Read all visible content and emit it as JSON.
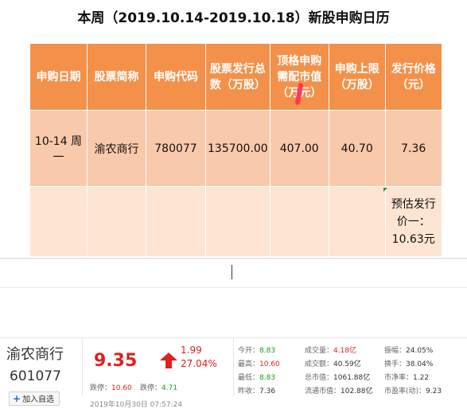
{
  "title": "本周（2019.10.14-2019.10.18）新股申购日历",
  "table": {
    "headers": [
      "申购日期",
      "股票简称",
      "申购代码",
      "股票发行总数（万股）",
      "顶格申购需配市值（万元）",
      "申购上限（万股）",
      "发行价格（元）"
    ],
    "row": [
      "10-14 周一",
      "渝农商行",
      "780077",
      "135700.00",
      "407.00",
      "40.70",
      "7.36"
    ],
    "note": "预估发行价一：10.63元"
  },
  "quote": {
    "name": "渝农商行",
    "code": "601077",
    "add_label": "加入自选",
    "price": "9.35",
    "change": "1.99",
    "change_pct": "27.04%",
    "limit_down_label": "跌停：",
    "limit_down": "10.60",
    "limit_up_label": "跌停：",
    "limit_up": "4.71",
    "time": "2019年10月30日 07:57:24",
    "stats": [
      {
        "label": "今开：",
        "value": "8.83",
        "color": "green"
      },
      {
        "label": "最高：",
        "value": "10.60",
        "color": "red"
      },
      {
        "label": "最低：",
        "value": "8.83",
        "color": "green"
      },
      {
        "label": "昨收：",
        "value": "7.36",
        "color": "plain"
      },
      {
        "label": "成交量：",
        "value": "4.18亿",
        "color": "red"
      },
      {
        "label": "成交额：",
        "value": "40.59亿",
        "color": "plain"
      },
      {
        "label": "总市值：",
        "value": "1061.88亿",
        "color": "plain"
      },
      {
        "label": "流通市值：",
        "value": "102.88亿",
        "color": "plain"
      },
      {
        "label": "振幅：",
        "value": "24.05%",
        "color": "plain"
      },
      {
        "label": "换手：",
        "value": "38.04%",
        "color": "plain"
      },
      {
        "label": "市净率：",
        "value": "1.22",
        "color": "plain"
      },
      {
        "label": "市盈率(动)：",
        "value": "9.23",
        "color": "plain"
      }
    ],
    "colors": {
      "up": "#e02020",
      "down": "#1a9a1a"
    }
  }
}
